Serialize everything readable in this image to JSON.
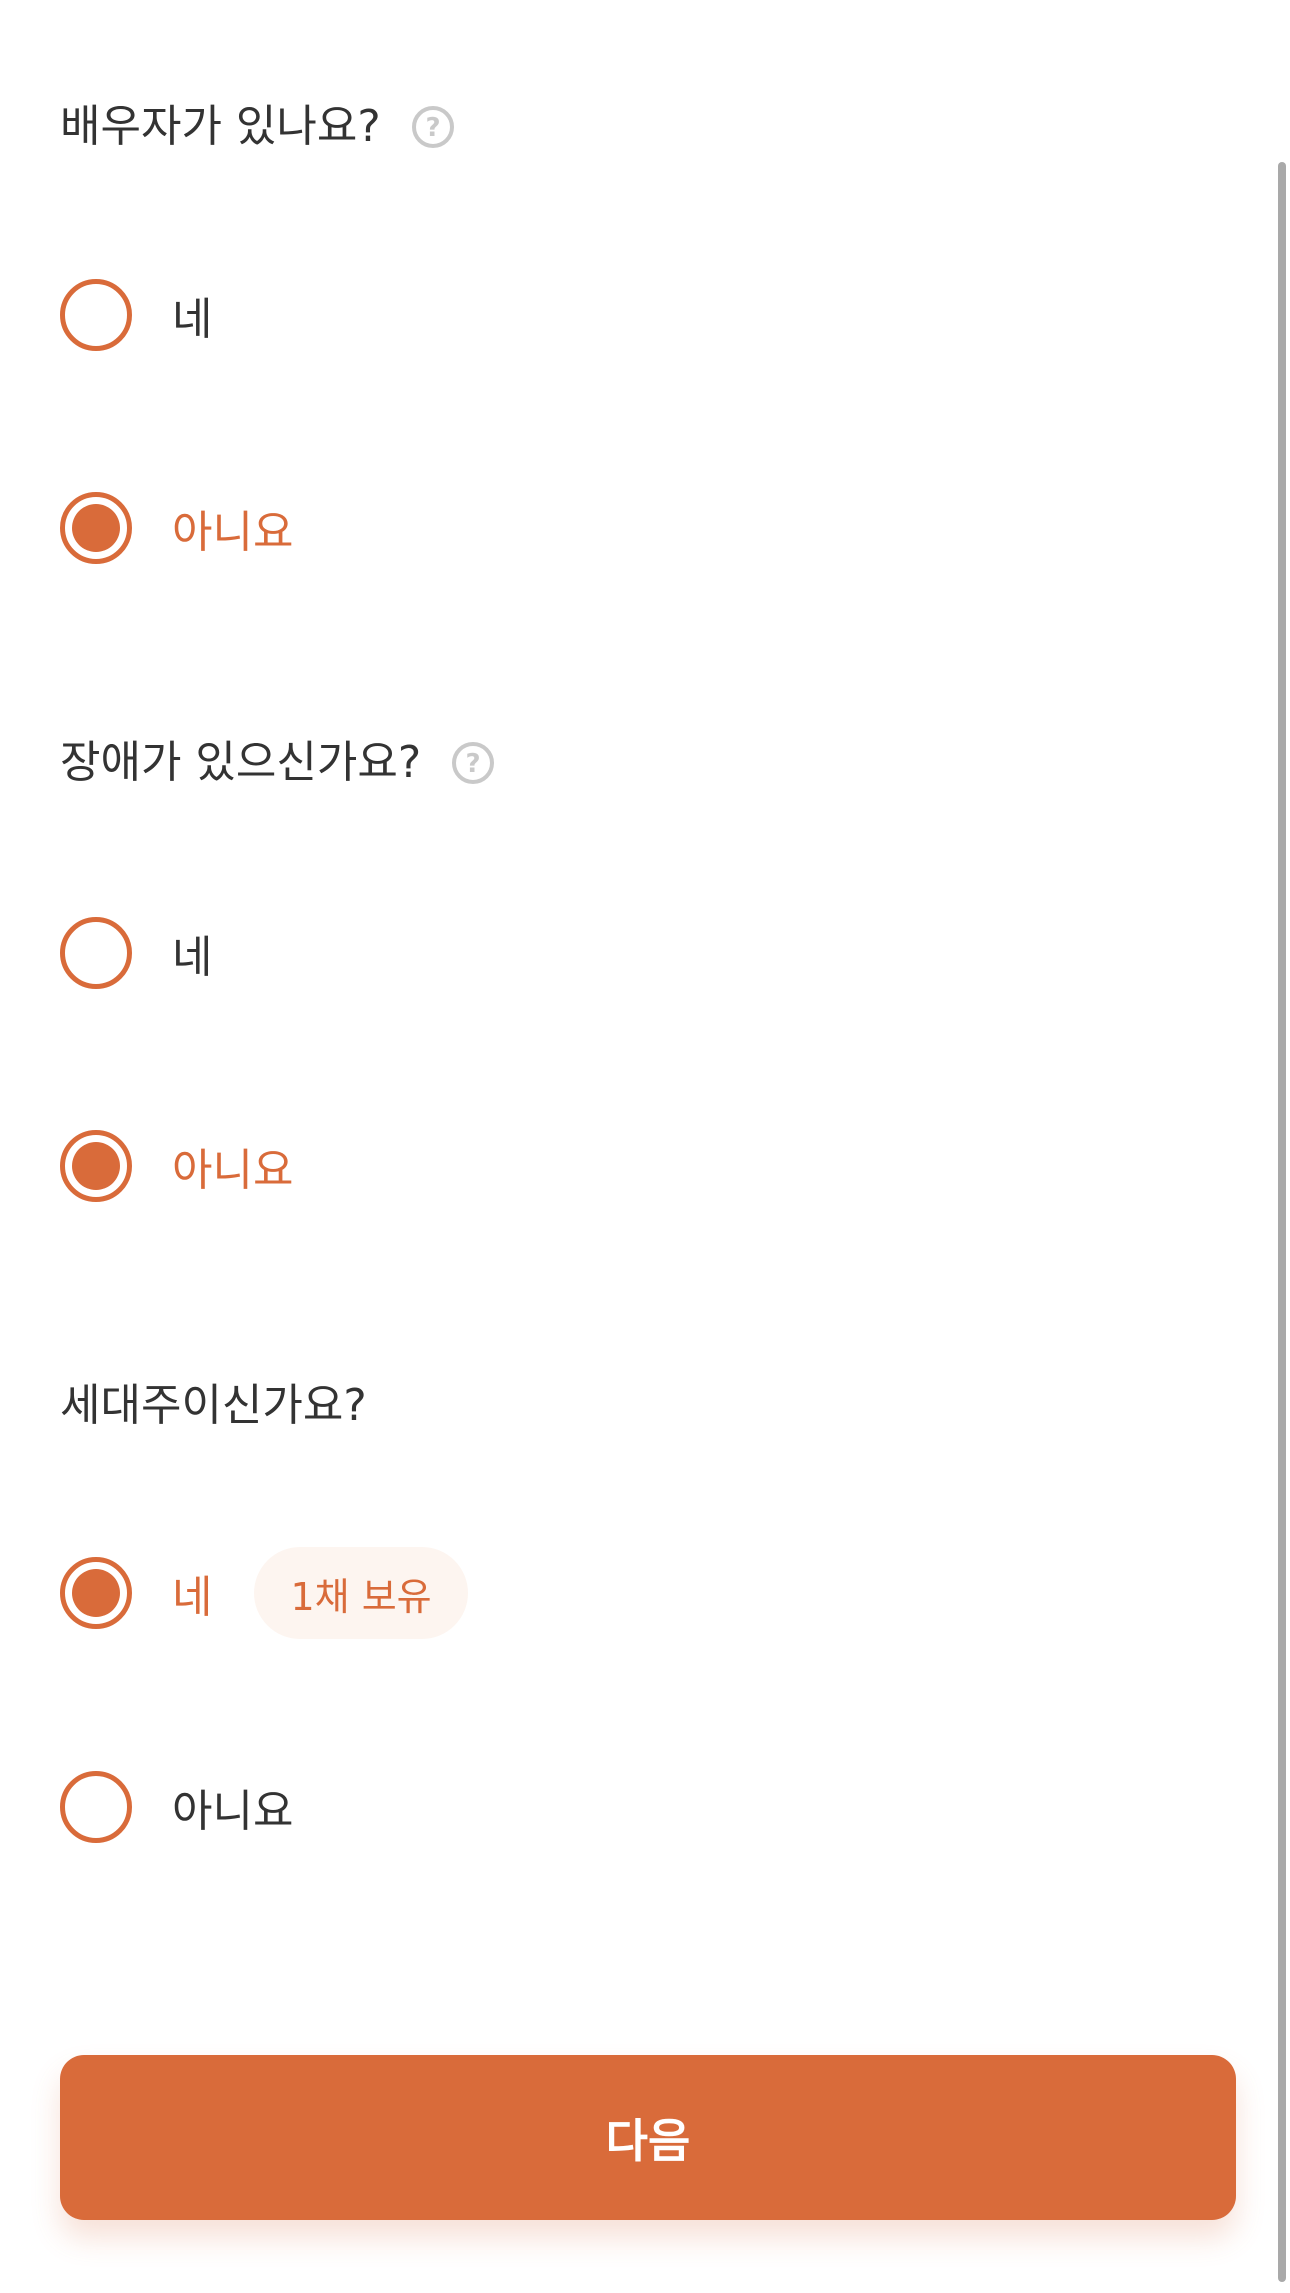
{
  "colors": {
    "accent": "#d96b3a",
    "text": "#333333",
    "help_icon": "#c9c9c9",
    "badge_bg": "#fdf5f0"
  },
  "questions": [
    {
      "title": "배우자가 있나요?",
      "has_help_icon": true,
      "options": [
        {
          "label": "네",
          "selected": false
        },
        {
          "label": "아니요",
          "selected": true
        }
      ]
    },
    {
      "title": "장애가 있으신가요?",
      "has_help_icon": true,
      "options": [
        {
          "label": "네",
          "selected": false
        },
        {
          "label": "아니요",
          "selected": true
        }
      ]
    },
    {
      "title": "세대주이신가요?",
      "has_help_icon": false,
      "options": [
        {
          "label": "네",
          "selected": true,
          "badge": "1채 보유"
        },
        {
          "label": "아니요",
          "selected": false
        }
      ]
    }
  ],
  "help_icon_glyph": "?",
  "footer": {
    "next_label": "다음"
  }
}
